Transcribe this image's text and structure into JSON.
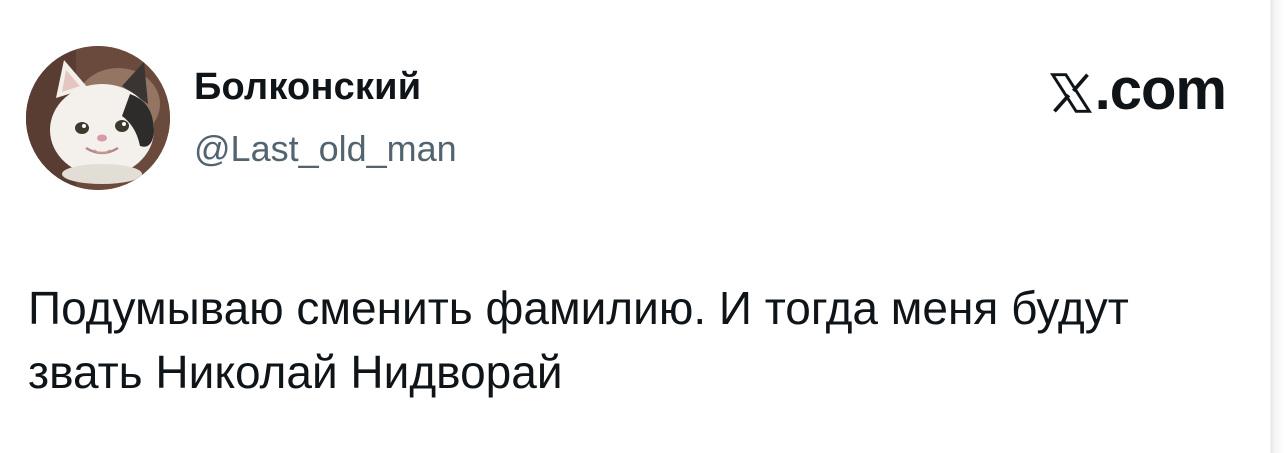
{
  "author": {
    "display_name": "Болконский",
    "handle": "@Last_old_man",
    "avatar": "white-cat-with-dark-patch-avatar"
  },
  "brand": {
    "logo_icon": "x-logo-icon",
    "domain_text": ".com"
  },
  "tweet": {
    "text": "Подумываю сменить фамилию. И тогда меня будут звать Николай Нидворай"
  },
  "colors": {
    "primary_text": "#0f1419",
    "secondary_text": "#536471",
    "background": "#ffffff"
  }
}
